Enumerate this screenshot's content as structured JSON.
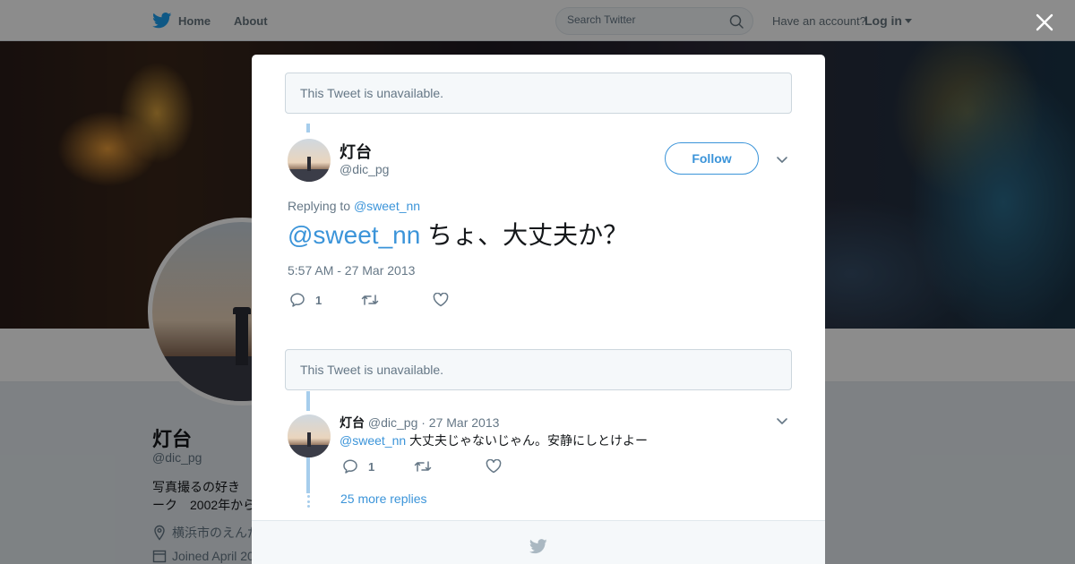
{
  "topbar": {
    "home_label": "Home",
    "about_label": "About",
    "search_placeholder": "Search Twitter",
    "have_account": "Have an account?",
    "login_label": "Log in"
  },
  "profile": {
    "name": "灯台",
    "handle": "@dic_pg",
    "bio": "写真撮るの好き　　ーク　2002年から",
    "location": "横浜市のえんだ",
    "joined": "Joined April 20"
  },
  "modal": {
    "unavailable_1": "This Tweet is unavailable.",
    "unavailable_2": "This Tweet is unavailable.",
    "main_tweet": {
      "name": "灯台",
      "handle": "@dic_pg",
      "follow_label": "Follow",
      "replying_prefix": "Replying to",
      "replying_to": "@sweet_nn",
      "mention": "@sweet_nn",
      "text": "ちょ、大丈夫か？",
      "timestamp": "5:57 AM - 27 Mar 2013",
      "reply_count": "1"
    },
    "reply_tweet": {
      "name": "灯台",
      "handle": "@dic_pg",
      "date": "· 27 Mar 2013",
      "mention": "@sweet_nn",
      "text": "大丈夫じゃないじゃん。安静にしとけよー",
      "reply_count": "1"
    },
    "more_replies": "25 more replies"
  },
  "icons": {
    "brand": "twitter-bird-icon",
    "search": "search-icon",
    "close": "close-icon",
    "reply": "reply-icon",
    "retweet": "retweet-icon",
    "like": "heart-icon",
    "chevron": "chevron-down-icon",
    "location": "location-pin-icon",
    "calendar": "calendar-icon"
  },
  "colors": {
    "brand_blue": "#1da1f2",
    "link_blue": "#3b94d9",
    "thread_line": "#a6cdec",
    "muted_text": "#657786"
  }
}
